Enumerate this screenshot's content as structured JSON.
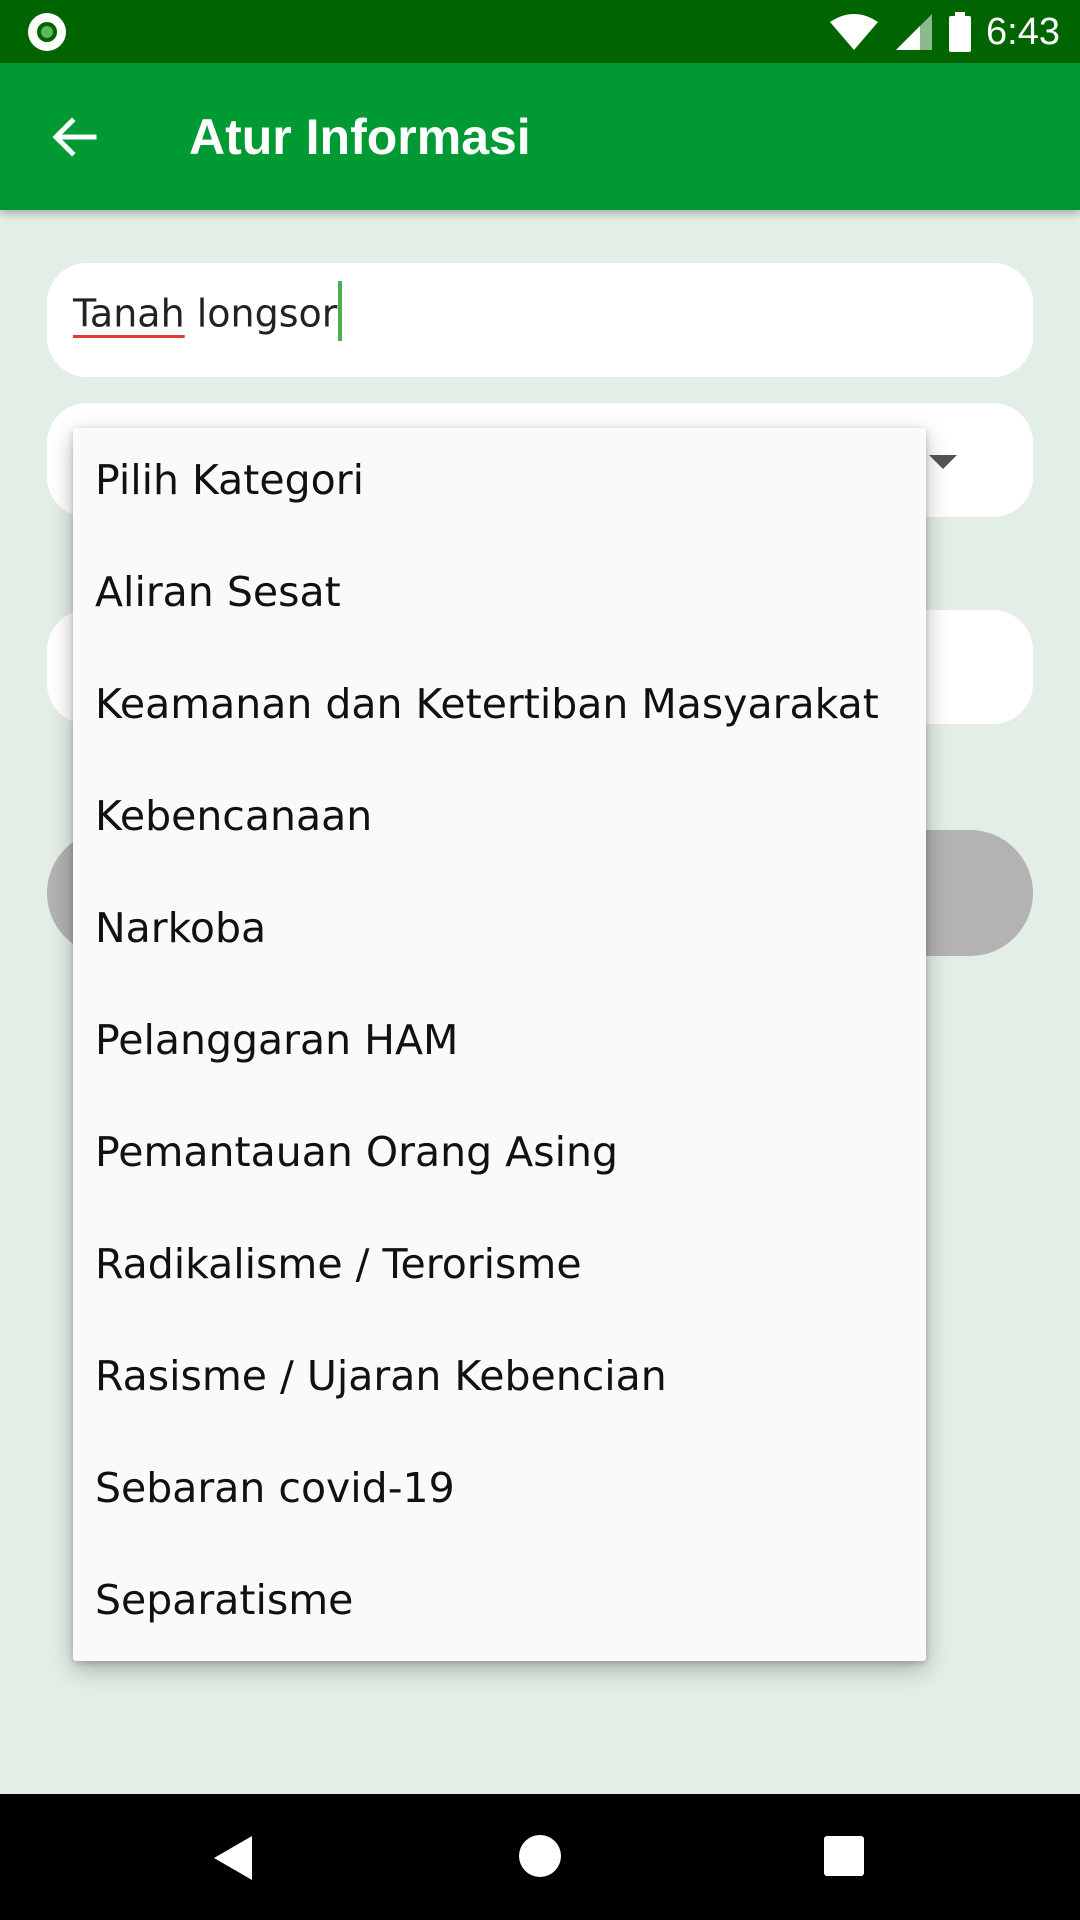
{
  "status_bar": {
    "time": "6:43",
    "icons": [
      "record-icon",
      "wifi-icon",
      "signal-icon",
      "battery-icon"
    ]
  },
  "app_bar": {
    "back_icon": "arrow-back-icon",
    "title": "Atur Informasi",
    "background_color": "#009933"
  },
  "form": {
    "info_input": {
      "value_misspelled": "Tanah",
      "value_rest": " longsor"
    },
    "category_select": {
      "caret_icon": "caret-down-icon"
    }
  },
  "dropdown": {
    "options": [
      "Pilih Kategori",
      "Aliran Sesat",
      "Keamanan dan Ketertiban Masyarakat",
      "Kebencanaan",
      "Narkoba",
      "Pelanggaran HAM",
      "Pemantauan Orang Asing",
      "Radikalisme / Terorisme",
      "Rasisme / Ujaran Kebencian",
      "Sebaran covid-19",
      "Separatisme"
    ]
  },
  "nav_bar": {
    "icons": [
      "nav-back-icon",
      "nav-home-icon",
      "nav-recents-icon"
    ]
  }
}
